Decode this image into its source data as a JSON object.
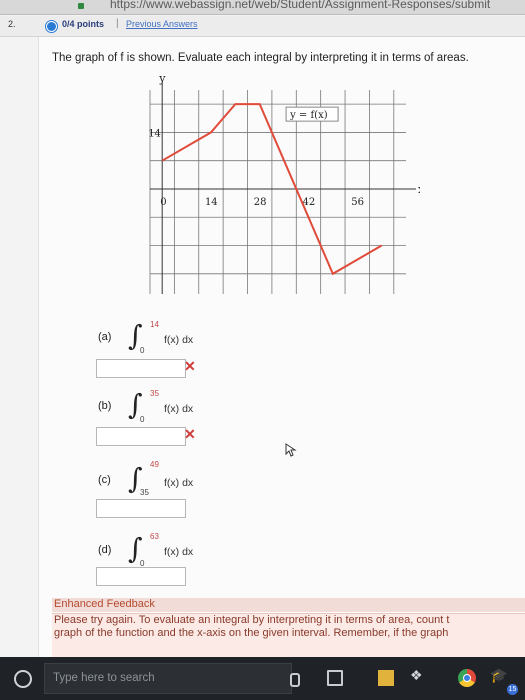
{
  "browser": {
    "url": "https://www.webassign.net/web/Student/Assignment-Responses/submit"
  },
  "question": {
    "number": "2.",
    "points": "0/4 points",
    "separator": "|",
    "previous_answers": "Previous Answers",
    "prompt": "The graph of f is shown. Evaluate each integral by interpreting it in terms of areas."
  },
  "graph": {
    "y_axis_label": "y",
    "x_axis_label": "x",
    "curve_label": "y = f(x)",
    "origin_label": "0",
    "y_tick_label": "14",
    "x_tick_labels": [
      "14",
      "28",
      "42",
      "56"
    ],
    "x_range": [
      -3.5,
      70
    ],
    "y_range": [
      -26,
      24.5
    ],
    "grid_step": 7,
    "series": [
      {
        "x": [
          0,
          14,
          21,
          28,
          35,
          49,
          63
        ],
        "y": [
          7,
          14,
          21,
          21,
          7,
          -21,
          -14
        ]
      }
    ],
    "line_color": "#e04b3a",
    "grid_color": "#777777"
  },
  "parts": [
    {
      "label": "(a)",
      "upper": "14",
      "lower": "0",
      "integrand": "f(x) dx",
      "answer": "",
      "mark": "✕"
    },
    {
      "label": "(b)",
      "upper": "35",
      "lower": "0",
      "integrand": "f(x) dx",
      "answer": "",
      "mark": "✕"
    },
    {
      "label": "(c)",
      "upper": "49",
      "lower": "35",
      "integrand": "f(x) dx",
      "answer": "",
      "mark": ""
    },
    {
      "label": "(d)",
      "upper": "63",
      "lower": "0",
      "integrand": "f(x) dx",
      "answer": "",
      "mark": ""
    }
  ],
  "feedback": {
    "title": "Enhanced Feedback",
    "line1": "Please try again. To evaluate an integral by interpreting it in terms of area, count t",
    "line2": "graph of the function and the x-axis on the given interval. Remember, if the graph"
  },
  "taskbar": {
    "search_placeholder": "Type here to search",
    "badge": "15"
  }
}
